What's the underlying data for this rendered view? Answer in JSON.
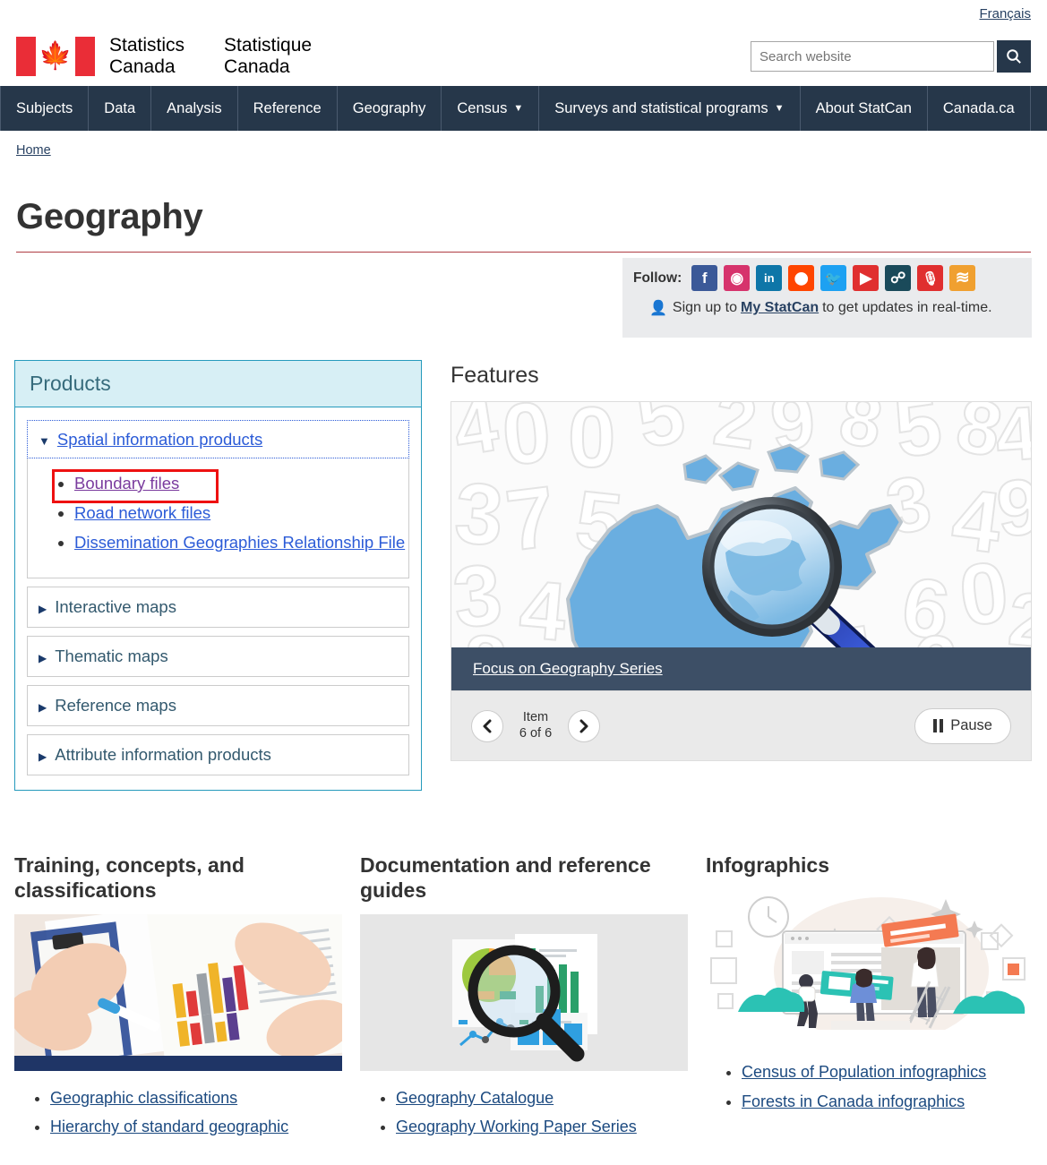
{
  "header": {
    "lang_link": "Français",
    "org_en": "Statistics\nCanada",
    "org_en_line1": "Statistics",
    "org_en_line2": "Canada",
    "org_fr_line1": "Statistique",
    "org_fr_line2": "Canada",
    "search_placeholder": "Search website",
    "search_value": "",
    "search_icon": "search-icon"
  },
  "nav": {
    "items": [
      {
        "label": "Subjects",
        "has_caret": false
      },
      {
        "label": "Data",
        "has_caret": false
      },
      {
        "label": "Analysis",
        "has_caret": false
      },
      {
        "label": "Reference",
        "has_caret": false
      },
      {
        "label": "Geography",
        "has_caret": false
      },
      {
        "label": "Census",
        "has_caret": true
      },
      {
        "label": "Surveys and statistical programs",
        "has_caret": true
      },
      {
        "label": "About StatCan",
        "has_caret": false
      },
      {
        "label": "Canada.ca",
        "has_caret": false
      }
    ]
  },
  "breadcrumb": {
    "home": "Home"
  },
  "page": {
    "title": "Geography",
    "accent_color": "#af3c43"
  },
  "follow": {
    "label": "Follow:",
    "icons": [
      {
        "name": "facebook-icon",
        "glyph": "f",
        "color": "#3b5998"
      },
      {
        "name": "instagram-icon",
        "glyph": "◉",
        "color": "#d6336c"
      },
      {
        "name": "linkedin-icon",
        "glyph": "in",
        "color": "#0e76a8"
      },
      {
        "name": "reddit-icon",
        "glyph": "⬤",
        "color": "#ff4500"
      },
      {
        "name": "twitter-icon",
        "glyph": "🐦",
        "color": "#1da1f2"
      },
      {
        "name": "youtube-icon",
        "glyph": "▶",
        "color": "#e02f2f"
      },
      {
        "name": "mobile-touch-icon",
        "glyph": "☍",
        "color": "#1a4a5a"
      },
      {
        "name": "podcast-microphone-icon",
        "glyph": "🎙",
        "color": "#e02f2f"
      },
      {
        "name": "rss-icon",
        "glyph": "≋",
        "color": "#f0a030"
      }
    ],
    "signup_prefix": "Sign up to",
    "signup_link": "My StatCan",
    "signup_suffix": "to get updates in real-time."
  },
  "products": {
    "heading": "Products",
    "expanded": {
      "label": "Spatial information products",
      "triangle": "▼",
      "children": [
        {
          "label": "Boundary files",
          "visited": true,
          "highlighted": true
        },
        {
          "label": "Road network files",
          "visited": false,
          "highlighted": false
        },
        {
          "label": "Dissemination Geographies Relationship File",
          "visited": false,
          "highlighted": false
        }
      ]
    },
    "collapsed": [
      {
        "label": "Interactive maps",
        "triangle": "▶"
      },
      {
        "label": "Thematic maps",
        "triangle": "▶"
      },
      {
        "label": "Reference maps",
        "triangle": "▶"
      },
      {
        "label": "Attribute information products",
        "triangle": "▶"
      }
    ],
    "highlight_color": "#ee1111"
  },
  "features": {
    "heading": "Features",
    "slide_caption": "Focus on Geography Series",
    "item_label": "Item",
    "item_position": "6 of 6",
    "current_item": 6,
    "total_items": 6,
    "prev_icon": "chevron-left-icon",
    "next_icon": "chevron-right-icon",
    "pause_label": "Pause",
    "pause_icon": "pause-icon"
  },
  "columns": [
    {
      "heading": "Training, concepts, and classifications",
      "image_name": "hands-analyzing-bar-chart-photo",
      "links": [
        "Geographic classifications",
        "Hierarchy of standard geographic"
      ]
    },
    {
      "heading": "Documentation and reference guides",
      "image_name": "magnifying-glass-over-charts-illustration",
      "links": [
        "Geography Catalogue",
        "Geography Working Paper Series"
      ]
    },
    {
      "heading": "Infographics",
      "image_name": "people-building-webpage-illustration",
      "links": [
        "Census of Population infographics",
        "Forests in Canada infographics"
      ]
    }
  ]
}
